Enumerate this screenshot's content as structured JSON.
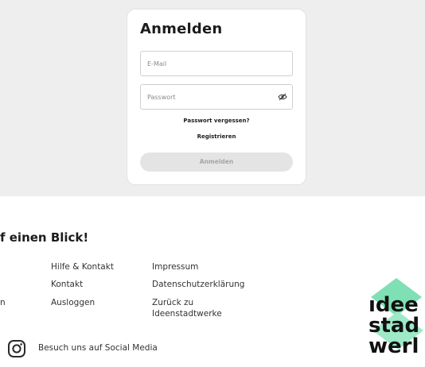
{
  "login": {
    "title": "Anmelden",
    "email_placeholder": "E-Mail",
    "password_placeholder": "Passwort",
    "forgot_password": "Passwort vergessen?",
    "register": "Registrieren",
    "submit_label": "Anmelden"
  },
  "footer": {
    "heading": "f einen Blick!",
    "col1": [
      "n"
    ],
    "col2": [
      "Hilfe & Kontakt",
      "Kontakt",
      "Ausloggen"
    ],
    "col3": [
      "Impressum",
      "Datenschutzerklärung",
      "Zurück zu",
      "Ideenstadtwerke"
    ],
    "social": "Besuch uns auf Social Media",
    "logo_lines": [
      "ıdee",
      "stad",
      "werl"
    ]
  },
  "icons": {
    "password_toggle": "eye-off-icon",
    "social": "instagram-icon",
    "logo": "brand-logo"
  },
  "colors": {
    "top_background": "#eeeeee",
    "logo_green": "#7ee0b4",
    "button_disabled": "#e4e4e4"
  }
}
